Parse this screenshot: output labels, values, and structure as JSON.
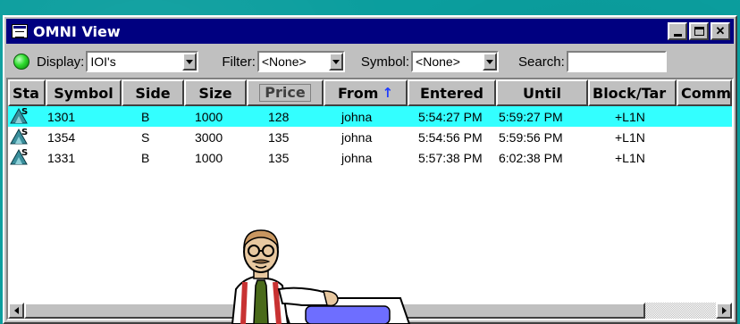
{
  "window": {
    "title": "OMNI View"
  },
  "toolbar": {
    "display_label": "Display:",
    "display_value": "IOI's",
    "filter_label": "Filter:",
    "filter_value": "<None>",
    "symbol_label": "Symbol:",
    "symbol_value": "<None>",
    "search_label": "Search:",
    "search_value": ""
  },
  "table": {
    "columns": [
      "Sta",
      "Symbol",
      "Side",
      "Size",
      "Price",
      "From",
      "Entered",
      "Until",
      "Block/Tar",
      "Comm"
    ],
    "rows": [
      {
        "status": "S",
        "symbol": "1301",
        "side": "B",
        "size": "1000",
        "price": "128",
        "from": "johna",
        "entered": "5:54:27 PM",
        "until": "5:59:27 PM",
        "block": "+L1N",
        "selected": true
      },
      {
        "status": "S",
        "symbol": "1354",
        "side": "S",
        "size": "3000",
        "price": "135",
        "from": "johna",
        "entered": "5:54:56 PM",
        "until": "5:59:56 PM",
        "block": "+L1N",
        "selected": false
      },
      {
        "status": "S",
        "symbol": "1331",
        "side": "B",
        "size": "1000",
        "price": "135",
        "from": "johna",
        "entered": "5:57:38 PM",
        "until": "6:02:38 PM",
        "block": "+L1N",
        "selected": false
      }
    ],
    "sort_column": "From",
    "sort_direction": "ascending"
  },
  "colors": {
    "titlebar": "#000080",
    "selected_row": "#33ffff",
    "status_indicator": "#2fdc2f",
    "desktop": "#0aa3a3"
  },
  "icons": [
    "app-icon",
    "status-led-icon",
    "dropdown-arrow-icon",
    "sort-up-arrow-icon",
    "status-triangle-icon",
    "minimize-icon",
    "maximize-icon",
    "close-icon"
  ]
}
